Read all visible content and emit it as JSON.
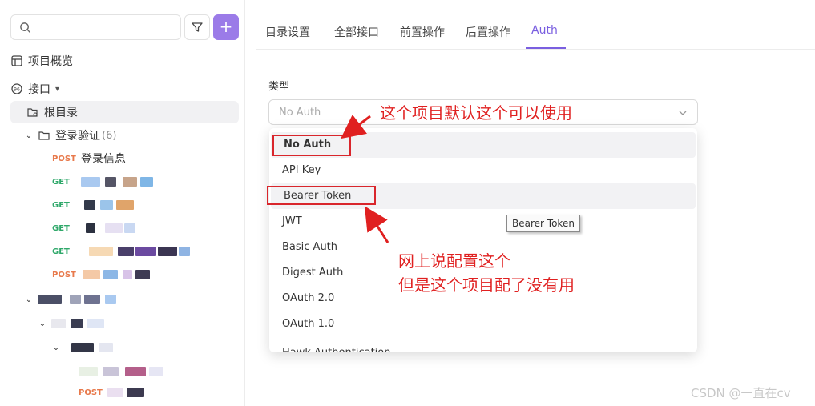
{
  "sidebar": {
    "search_placeholder": "",
    "add_label": "+",
    "overview_label": "项目概览",
    "interfaces_label": "接口",
    "root_label": "根目录",
    "folder_label": "登录验证",
    "folder_count": "(6)",
    "requests": [
      {
        "method": "POST",
        "label": "登录信息"
      },
      {
        "method": "GET",
        "label": ""
      },
      {
        "method": "GET",
        "label": ""
      },
      {
        "method": "GET",
        "label": ""
      },
      {
        "method": "GET",
        "label": ""
      },
      {
        "method": "POST",
        "label": ""
      }
    ],
    "bottom_post": "POST"
  },
  "tabs": [
    {
      "label": "目录设置"
    },
    {
      "label": "全部接口"
    },
    {
      "label": "前置操作"
    },
    {
      "label": "后置操作"
    },
    {
      "label": "Auth"
    }
  ],
  "auth": {
    "type_label": "类型",
    "selected": "No Auth",
    "options": [
      "No Auth",
      "API Key",
      "Bearer Token",
      "JWT",
      "Basic Auth",
      "Digest Auth",
      "OAuth 2.0",
      "OAuth 1.0",
      "Hawk Authentication"
    ],
    "tooltip": "Bearer Token"
  },
  "annotations": {
    "note1": "这个项目默认这个可以使用",
    "note2_line1": "网上说配置这个",
    "note2_line2": "但是这个项目配了没有用"
  },
  "watermark": "CSDN @一直在cv",
  "colors": {
    "accent": "#7a5fe0",
    "add_button": "#9b7be8",
    "annotation_red": "#e02020",
    "post": "#e8794b",
    "get": "#2fa86a"
  }
}
